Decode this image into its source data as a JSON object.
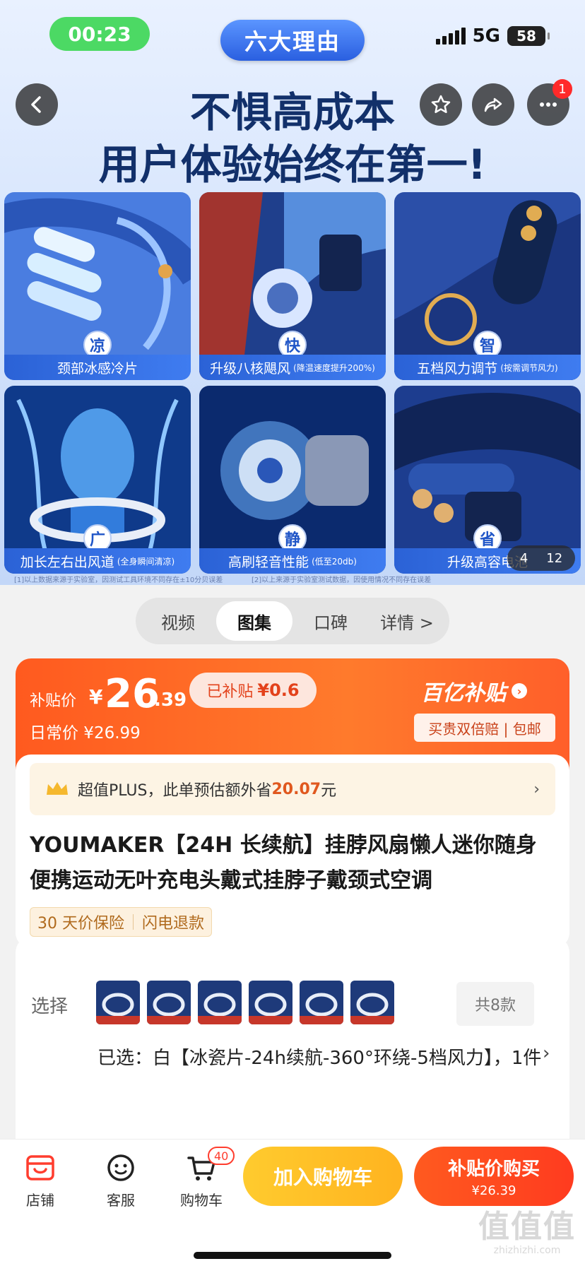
{
  "status_bar": {
    "time": "00:23",
    "network": "5G",
    "battery": "58"
  },
  "hero": {
    "pill": "六大理由",
    "title_line1": "不惧高成本",
    "title_line2": "用户体验始终在第一!",
    "more_badge": "1",
    "tiles": [
      {
        "badge": "凉",
        "caption": "颈部冰感冷片",
        "note": ""
      },
      {
        "badge": "快",
        "caption": "升级八核飓风",
        "note": "(降温速度提升200%)"
      },
      {
        "badge": "智",
        "caption": "五档风力调节",
        "note": "(按需调节风力)"
      },
      {
        "badge": "广",
        "caption": "加长左右出风道",
        "note": "(全身瞬间清凉)"
      },
      {
        "badge": "静",
        "caption": "高刷轻音性能",
        "note": "(低至20db)"
      },
      {
        "badge": "省",
        "caption": "升级高容电池",
        "note": ""
      }
    ],
    "disclaimer_left": "[1]以上数据来源于实验室，因测试工具环境不同存在±10分贝误差",
    "disclaimer_right": "[2]以上来源于实验室测试数据，因使用情况不同存在误差",
    "pager_current": "4",
    "pager_total": "12"
  },
  "tabs": [
    {
      "label": "视频",
      "active": false
    },
    {
      "label": "图集",
      "active": true
    },
    {
      "label": "口碑",
      "active": false
    },
    {
      "label": "详情 >",
      "active": false
    }
  ],
  "price": {
    "label": "补贴价",
    "yen": "¥",
    "integer": "26",
    "decimal": ".39",
    "subsidy_label": "已补贴",
    "subsidy_value": "¥0.6",
    "daily_price": "日常价 ¥26.99",
    "brand": "百亿补贴",
    "guarantee": "买贵双倍赔 | 包邮"
  },
  "plus": {
    "prefix": "超值PLUS，此单预估额外省",
    "amount": "20.07",
    "suffix": "元"
  },
  "product": {
    "title": "YOUMAKER【24H 长续航】挂脖风扇懒人迷你随身便携运动无叶充电头戴式挂脖子戴颈式空调",
    "tag1": "30 天价保险",
    "tag2": "闪电退款"
  },
  "sku": {
    "label": "选择",
    "count": "共8款",
    "selected": "已选：白【冰瓷片-24h续航-360°环绕-5档风力】，1件"
  },
  "bottom_bar": {
    "store": "店铺",
    "service": "客服",
    "cart": "购物车",
    "cart_count": "40",
    "add_cart": "加入购物车",
    "buy_now": "补贴价购买",
    "buy_price": "¥26.39"
  },
  "watermark": {
    "big": "值值值",
    "small": "zhizhizhi.com"
  }
}
